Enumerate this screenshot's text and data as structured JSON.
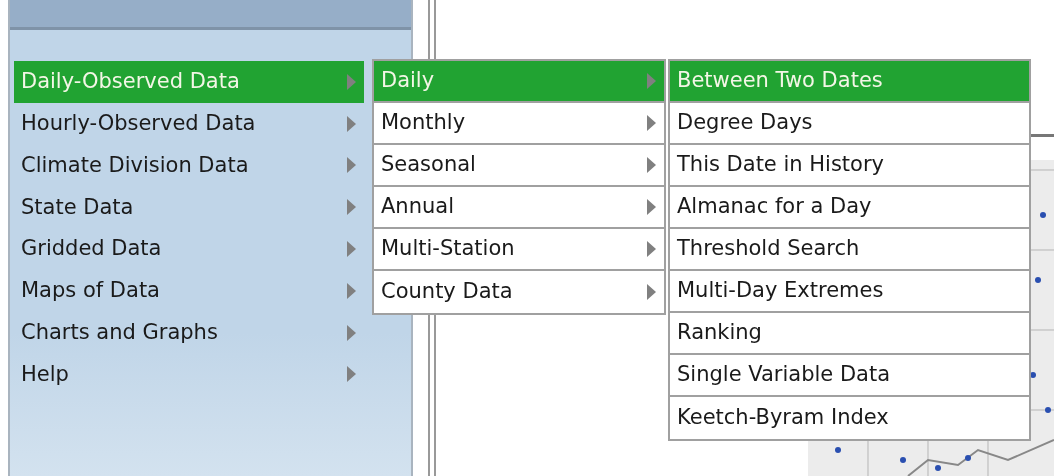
{
  "main_menu": {
    "items": [
      {
        "label": "Daily-Observed Data",
        "selected": true,
        "has_submenu": true
      },
      {
        "label": "Hourly-Observed Data",
        "selected": false,
        "has_submenu": true
      },
      {
        "label": "Climate Division Data",
        "selected": false,
        "has_submenu": true
      },
      {
        "label": "State Data",
        "selected": false,
        "has_submenu": true
      },
      {
        "label": "Gridded Data",
        "selected": false,
        "has_submenu": true
      },
      {
        "label": "Maps of Data",
        "selected": false,
        "has_submenu": true
      },
      {
        "label": "Charts and Graphs",
        "selected": false,
        "has_submenu": true
      },
      {
        "label": "Help",
        "selected": false,
        "has_submenu": true
      }
    ]
  },
  "submenu": {
    "items": [
      {
        "label": "Daily",
        "selected": true,
        "has_submenu": true
      },
      {
        "label": "Monthly",
        "selected": false,
        "has_submenu": true
      },
      {
        "label": "Seasonal",
        "selected": false,
        "has_submenu": true
      },
      {
        "label": "Annual",
        "selected": false,
        "has_submenu": true
      },
      {
        "label": "Multi-Station",
        "selected": false,
        "has_submenu": true
      },
      {
        "label": "County Data",
        "selected": false,
        "has_submenu": true
      }
    ]
  },
  "sub_submenu": {
    "items": [
      {
        "label": "Between Two Dates",
        "selected": true,
        "has_submenu": false
      },
      {
        "label": "Degree Days",
        "selected": false,
        "has_submenu": false
      },
      {
        "label": "This Date in History",
        "selected": false,
        "has_submenu": false
      },
      {
        "label": "Almanac for a Day",
        "selected": false,
        "has_submenu": false
      },
      {
        "label": "Threshold Search",
        "selected": false,
        "has_submenu": false
      },
      {
        "label": "Multi-Day Extremes",
        "selected": false,
        "has_submenu": false
      },
      {
        "label": "Ranking",
        "selected": false,
        "has_submenu": false
      },
      {
        "label": "Single Variable Data",
        "selected": false,
        "has_submenu": false
      },
      {
        "label": "Keetch-Byram Index",
        "selected": false,
        "has_submenu": false
      }
    ]
  }
}
